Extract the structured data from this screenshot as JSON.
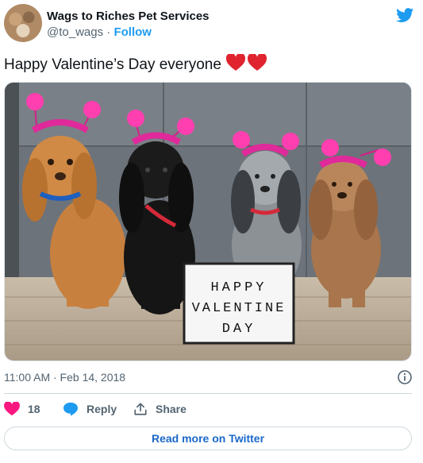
{
  "author": {
    "name": "Wags to Riches Pet Services",
    "handle": "@to_wags",
    "separator": " · ",
    "follow_label": "Follow"
  },
  "tweet": {
    "text": "Happy Valentine’s Day everyone"
  },
  "photo": {
    "sign_lines": [
      "HAPPY",
      "VALENTINE",
      "DAY"
    ]
  },
  "meta": {
    "timestamp": "11:00 AM · Feb 14, 2018"
  },
  "actions": {
    "like_count": "18",
    "reply_label": "Reply",
    "share_label": "Share"
  },
  "read_more": {
    "label": "Read more on Twitter"
  },
  "icons": {
    "twitter": "twitter-bird-icon",
    "info": "info-icon",
    "like": "heart-icon",
    "reply": "reply-bubble-icon",
    "share": "share-icon"
  },
  "colors": {
    "twitter_blue": "#1d9bf0",
    "like_red": "#f91880",
    "heart_emoji": "#e0242f",
    "link": "#1b68c9"
  }
}
